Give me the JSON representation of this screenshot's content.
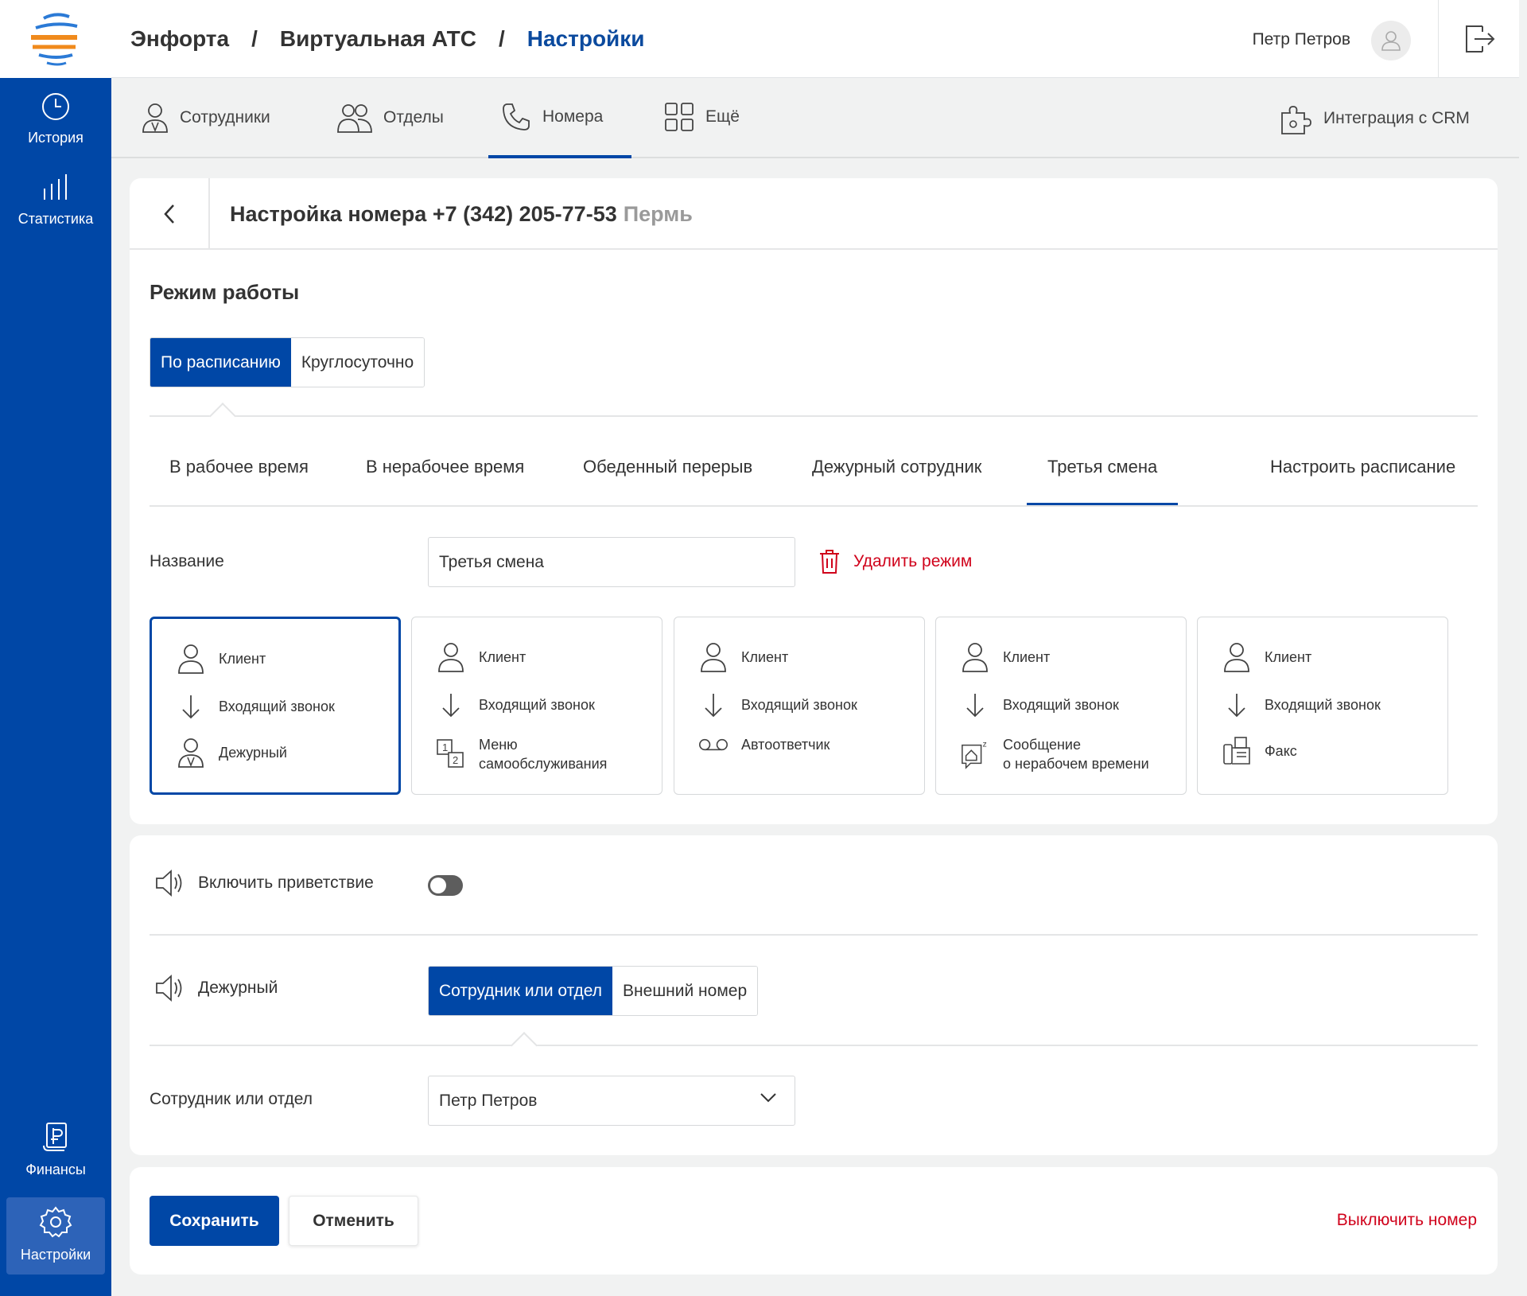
{
  "sidebar": {
    "items": [
      {
        "label": "История",
        "icon": "clock-icon"
      },
      {
        "label": "Статистика",
        "icon": "bar-chart-icon"
      },
      {
        "label": "Финансы",
        "icon": "ruble-document-icon"
      },
      {
        "label": "Настройки",
        "icon": "gear-icon"
      }
    ]
  },
  "header": {
    "breadcrumb": [
      "Энфорта",
      "Виртуальная АТС",
      "Настройки"
    ],
    "separator": "/",
    "user_name": "Петр Петров"
  },
  "nav": {
    "items": [
      {
        "label": "Сотрудники",
        "icon": "employee-icon"
      },
      {
        "label": "Отделы",
        "icon": "departments-icon"
      },
      {
        "label": "Номера",
        "icon": "phone-icon"
      },
      {
        "label": "Ещё",
        "icon": "grid-icon"
      }
    ],
    "crm_label": "Интеграция с CRM"
  },
  "settings": {
    "title": "Настройка номера +7 (342) 205-77-53",
    "city": "Пермь",
    "section_title": "Режим работы",
    "mode_options": [
      "По расписанию",
      "Круглосуточно"
    ],
    "tabs": [
      "В рабочее время",
      "В нерабочее время",
      "Обеденный перерыв",
      "Дежурный сотрудник",
      "Третья смена",
      "Настроить расписание"
    ],
    "name_label": "Название",
    "name_value": "Третья смена",
    "delete_label": "Удалить режим",
    "flow_cards": [
      {
        "r1": "Клиент",
        "r2": "Входящий звонок",
        "r3a": "Дежурный",
        "r3b": ""
      },
      {
        "r1": "Клиент",
        "r2": "Входящий звонок",
        "r3a": "Меню",
        "r3b": "самообслуживания"
      },
      {
        "r1": "Клиент",
        "r2": "Входящий звонок",
        "r3a": "Автоответчик",
        "r3b": ""
      },
      {
        "r1": "Клиент",
        "r2": "Входящий звонок",
        "r3a": "Сообщение",
        "r3b": "о нерабочем времени"
      },
      {
        "r1": "Клиент",
        "r2": "Входящий звонок",
        "r3a": "Факс",
        "r3b": ""
      }
    ]
  },
  "greeting": {
    "label": "Включить приветствие",
    "enabled": false
  },
  "duty": {
    "label": "Дежурный",
    "options": [
      "Сотрудник или отдел",
      "Внешний номер"
    ],
    "field_label": "Сотрудник или отдел",
    "selected": "Петр Петров"
  },
  "actions": {
    "save": "Сохранить",
    "cancel": "Отменить",
    "disable": "Выключить номер"
  },
  "colors": {
    "primary": "#0047a6",
    "danger": "#d0021b"
  }
}
